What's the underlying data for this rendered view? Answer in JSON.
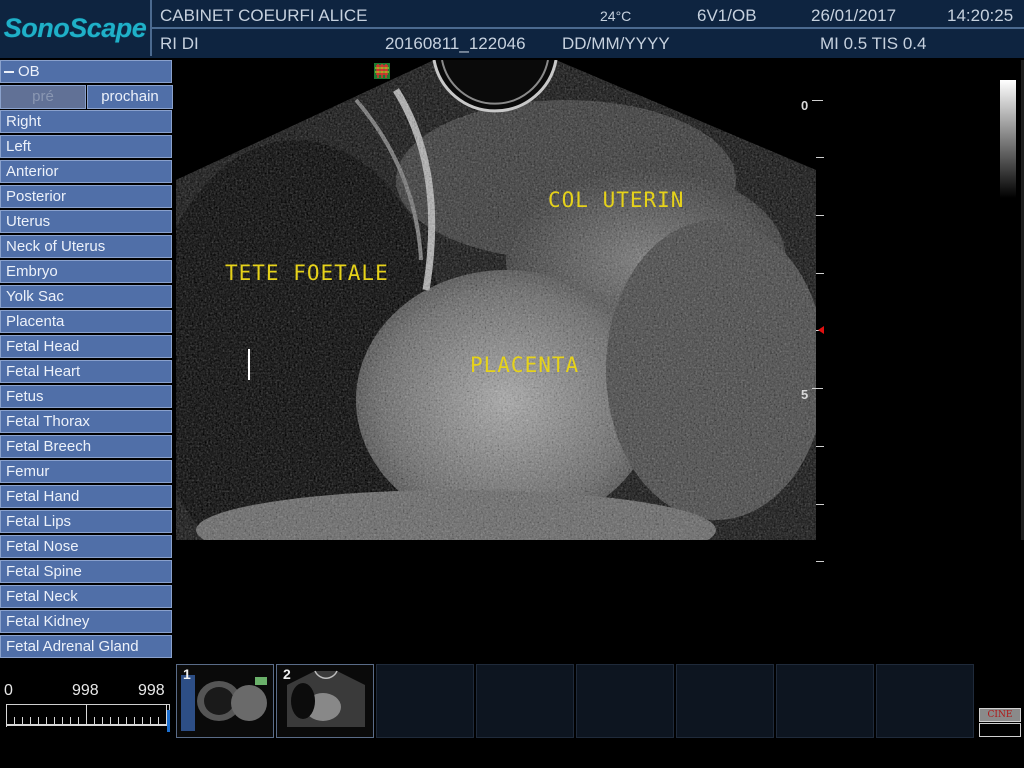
{
  "header": {
    "brand": "SonoScape",
    "clinic": "CABINET COEURFI ALICE",
    "temperature": "24°C",
    "probe_preset": "6V1/OB",
    "date": "26/01/2017",
    "time": "14:20:25",
    "patient": "RI DI",
    "exam_id": "20160811_122046",
    "date_format": "DD/MM/YYYY",
    "indices": "MI 0.5 TIS 0.4"
  },
  "menu": {
    "category": "OB",
    "prev_label": "pré",
    "next_label": "prochain",
    "items": [
      "Right",
      "Left",
      "Anterior",
      "Posterior",
      "Uterus",
      "Neck of Uterus",
      "Embryo",
      "Yolk Sac",
      "Placenta",
      "Fetal Head",
      "Fetal Heart",
      "Fetus",
      "Fetal Thorax",
      "Fetal Breech",
      "Femur",
      "Fetal Hand",
      "Fetal Lips",
      "Fetal Nose",
      "Fetal Spine",
      "Fetal Neck",
      "Fetal Kidney",
      "Fetal Adrenal Gland"
    ]
  },
  "image": {
    "annotations": {
      "fetal_head": "TETE FOETALE",
      "cervix": "COL UTERIN",
      "placenta": "PLACENTA"
    },
    "depth_scale": {
      "top": "0",
      "mid": "5"
    }
  },
  "cine": {
    "start": "0",
    "current": "998",
    "end": "998",
    "button_label": "CINE"
  },
  "thumbnails": [
    {
      "number": "1"
    },
    {
      "number": "2"
    }
  ],
  "colors": {
    "header_bg": "#0e2440",
    "menu_item_bg": "#506fa8",
    "annotation": "#e6d21a",
    "brand": "#1fb0c8"
  }
}
